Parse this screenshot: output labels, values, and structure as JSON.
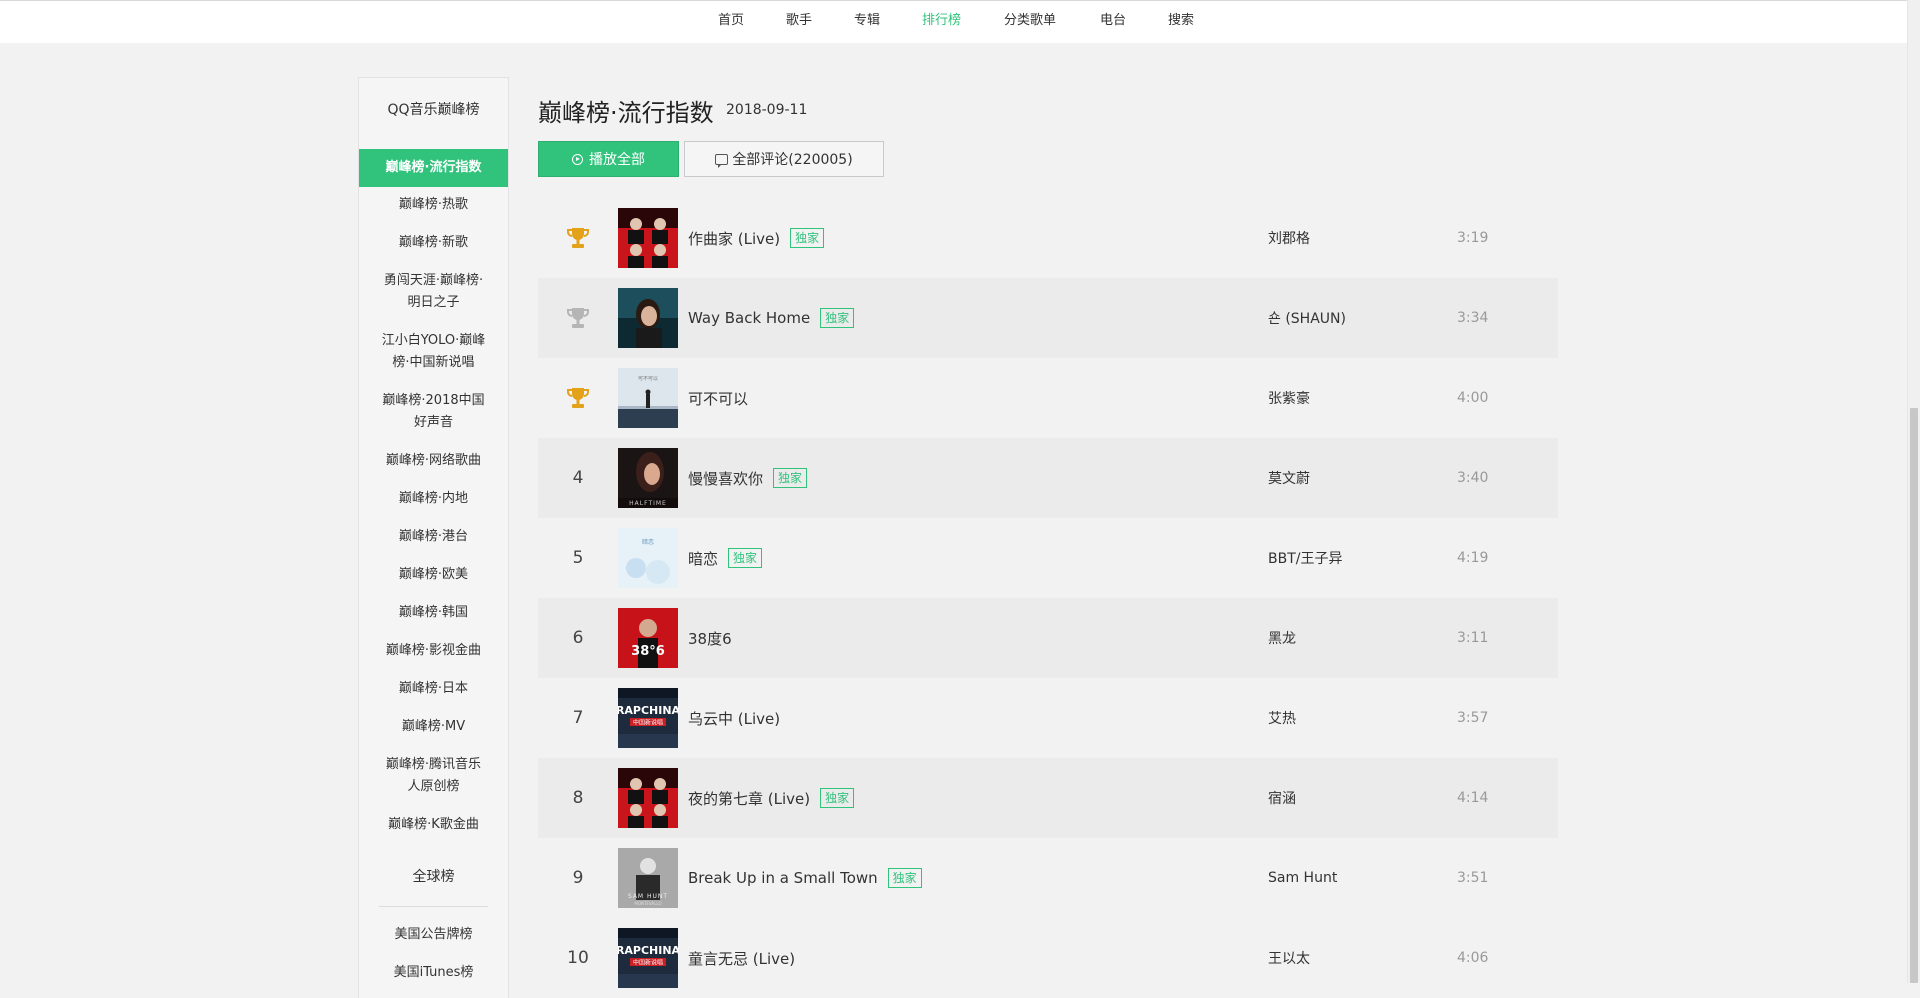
{
  "nav": {
    "items": [
      "首页",
      "歌手",
      "专辑",
      "排行榜",
      "分类歌单",
      "电台",
      "搜索"
    ],
    "active": "排行榜"
  },
  "sidebar": {
    "group1_title": "QQ音乐巅峰榜",
    "items": [
      "巅峰榜·流行指数",
      "巅峰榜·热歌",
      "巅峰榜·新歌",
      "勇闯天涯·巅峰榜·",
      "明日之子",
      "江小白YOLO·巅峰",
      "榜·中国新说唱",
      "巅峰榜·2018中国",
      "好声音",
      "巅峰榜·网络歌曲",
      "巅峰榜·内地",
      "巅峰榜·港台",
      "巅峰榜·欧美",
      "巅峰榜·韩国",
      "巅峰榜·影视金曲",
      "巅峰榜·日本",
      "巅峰榜·MV",
      "巅峰榜·腾讯音乐",
      "人原创榜",
      "巅峰榜·K歌金曲"
    ],
    "group2_title": "全球榜",
    "global_items": [
      "美国公告牌榜",
      "美国iTunes榜"
    ]
  },
  "header": {
    "title": "巅峰榜·流行指数",
    "date": "2018-09-11",
    "play_all": "播放全部",
    "comments": "全部评论(220005)"
  },
  "colors": {
    "accent": "#31c27c",
    "gold": "#e3a21a",
    "silver": "#b5b5b5"
  },
  "songs": [
    {
      "rank": "1",
      "icon": "gold-trophy-icon",
      "title": "作曲家 (Live)",
      "badge": "独家",
      "artist": "刘郡格",
      "duration": "3:19"
    },
    {
      "rank": "2",
      "icon": "silver-trophy-icon",
      "title": "Way Back Home",
      "badge": "独家",
      "artist": "숀 (SHAUN)",
      "duration": "3:34"
    },
    {
      "rank": "3",
      "icon": "bronze-trophy-icon",
      "title": "可不可以",
      "badge": "",
      "artist": "张紫豪",
      "duration": "4:00"
    },
    {
      "rank": "4",
      "icon": "",
      "title": "慢慢喜欢你",
      "badge": "独家",
      "artist": "莫文蔚",
      "duration": "3:40"
    },
    {
      "rank": "5",
      "icon": "",
      "title": "暗恋",
      "badge": "独家",
      "artist": "BBT/王子异",
      "duration": "4:19"
    },
    {
      "rank": "6",
      "icon": "",
      "title": "38度6",
      "badge": "",
      "artist": "黑龙",
      "duration": "3:11"
    },
    {
      "rank": "7",
      "icon": "",
      "title": "乌云中 (Live)",
      "badge": "",
      "artist": "艾热",
      "duration": "3:57"
    },
    {
      "rank": "8",
      "icon": "",
      "title": "夜的第七章 (Live)",
      "badge": "独家",
      "artist": "宿涵",
      "duration": "4:14"
    },
    {
      "rank": "9",
      "icon": "",
      "title": "Break Up in a Small Town",
      "badge": "独家",
      "artist": "Sam Hunt",
      "duration": "3:51"
    },
    {
      "rank": "10",
      "icon": "",
      "title": "童言无忌 (Live)",
      "badge": "",
      "artist": "王以太",
      "duration": "4:06"
    }
  ]
}
